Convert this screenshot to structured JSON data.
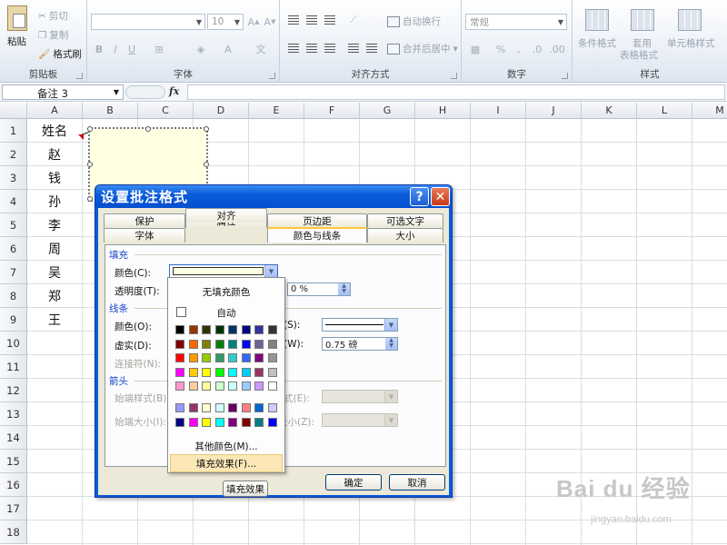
{
  "ribbon": {
    "clipboard": {
      "label": "剪贴板",
      "paste": "粘贴",
      "cut": "剪切",
      "copy": "复制",
      "format_painter": "格式刷"
    },
    "font": {
      "label": "字体",
      "size": "10",
      "bold": "B",
      "italic": "I",
      "underline": "U"
    },
    "alignment": {
      "label": "对齐方式",
      "wrap_text": "自动换行",
      "merge_center": "合并后居中"
    },
    "number": {
      "label": "数字",
      "format": "常规",
      "percent": "%"
    },
    "styles": {
      "label": "样式",
      "conditional": "条件格式",
      "table_line1": "套用",
      "table_line2": "表格格式",
      "cell_styles": "单元格样式"
    }
  },
  "formula_bar": {
    "name_box": "备注 3",
    "fx": "fx",
    "formula": ""
  },
  "columns": [
    "A",
    "B",
    "C",
    "D",
    "E",
    "F",
    "G",
    "H",
    "I",
    "J",
    "K",
    "L",
    "M"
  ],
  "rows": [
    "1",
    "2",
    "3",
    "4",
    "5",
    "6",
    "7",
    "8",
    "9",
    "10",
    "11",
    "12",
    "13",
    "14",
    "15",
    "16",
    "17",
    "18"
  ],
  "cells": {
    "A1": "姓名",
    "A2": "赵",
    "A3": "钱",
    "A4": "孙",
    "A5": "李",
    "A6": "周",
    "A7": "吴",
    "A8": "郑",
    "A9": "王"
  },
  "dialog": {
    "title": "设置批注格式",
    "help": "?",
    "close": "✕",
    "tabs_back": [
      "保护",
      "属性",
      "页边距",
      "可选文字"
    ],
    "tabs_front": [
      "字体",
      "对齐",
      "颜色与线条",
      "大小"
    ],
    "fill_section": "填充",
    "color_label": "颜色(C):",
    "transparency_label": "透明度(T):",
    "transparency_value": "0 %",
    "line_section": "线条",
    "line_color_label": "颜色(O):",
    "dash_label": "虚实(D):",
    "style_suffix": "(S):",
    "weight_suffix": "(W):",
    "weight_value": "0.75 磅",
    "connector_label": "连接符(N):",
    "arrows_section": "箭头",
    "begin_style_label": "始端样式(B):",
    "begin_size_label": "始端大小(I):",
    "end_style_suffix": "式(E):",
    "end_size_suffix": "大小(Z):",
    "fill_effects_button": "填充效果",
    "ok": "确定",
    "cancel": "取消",
    "fill_color_value": "#ffffe1"
  },
  "color_menu": {
    "no_fill": "无填充颜色",
    "automatic": "自动",
    "more_colors": "其他颜色(M)...",
    "fill_effects": "填充效果(F)...",
    "palette": [
      [
        "#000000",
        "#993300",
        "#333300",
        "#003300",
        "#003366",
        "#000080",
        "#333399",
        "#333333"
      ],
      [
        "#800000",
        "#ff6600",
        "#808000",
        "#008000",
        "#008080",
        "#0000ff",
        "#666699",
        "#808080"
      ],
      [
        "#ff0000",
        "#ff9900",
        "#99cc00",
        "#339966",
        "#33cccc",
        "#3366ff",
        "#800080",
        "#969696"
      ],
      [
        "#ff00ff",
        "#ffcc00",
        "#ffff00",
        "#00ff00",
        "#00ffff",
        "#00ccff",
        "#993366",
        "#c0c0c0"
      ],
      [
        "#ff99cc",
        "#ffcc99",
        "#ffff99",
        "#ccffcc",
        "#ccffff",
        "#99ccff",
        "#cc99ff",
        "#ffffff"
      ]
    ],
    "chart_palette": [
      [
        "#9999ff",
        "#993366",
        "#ffffcc",
        "#ccffff",
        "#660066",
        "#ff8080",
        "#0066cc",
        "#ccccff"
      ],
      [
        "#000080",
        "#ff00ff",
        "#ffff00",
        "#00ffff",
        "#800080",
        "#800000",
        "#008080",
        "#0000ff"
      ]
    ]
  },
  "watermark": {
    "brand": "Bai du 经验",
    "url": "jingyan.baidu.com"
  }
}
